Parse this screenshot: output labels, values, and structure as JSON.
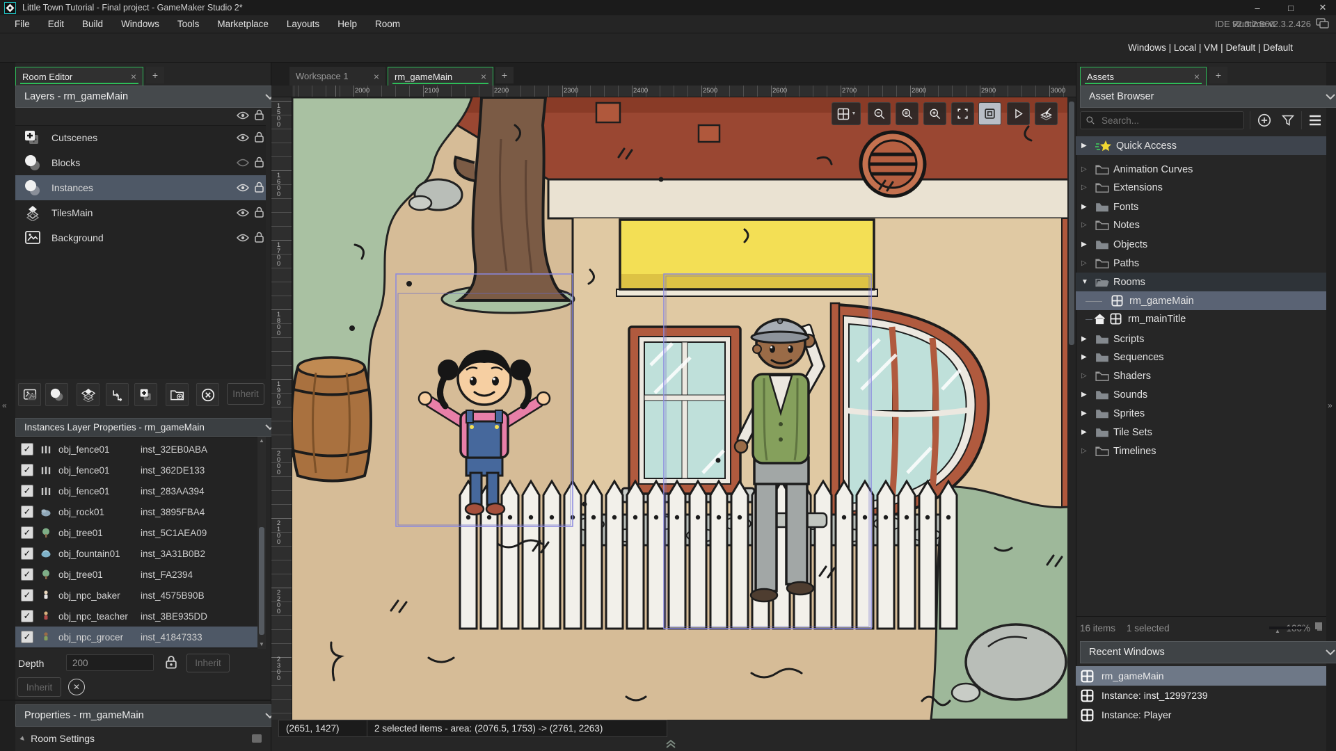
{
  "window": {
    "title": "Little Town Tutorial - Final project - GameMaker Studio 2*"
  },
  "menu": {
    "items": [
      "File",
      "Edit",
      "Build",
      "Windows",
      "Tools",
      "Marketplace",
      "Layouts",
      "Help",
      "Room"
    ],
    "ide_version": "IDE v2.3.2.560",
    "runtime_version": "Runtime v2.3.2.426"
  },
  "toolbar": {
    "target_config": "Windows | Local | VM | Default | Default"
  },
  "left_panel": {
    "tab_label": "Room Editor",
    "layers_header": "Layers - rm_gameMain",
    "layers": [
      {
        "label": "Cutscenes"
      },
      {
        "label": "Blocks"
      },
      {
        "label": "Instances"
      },
      {
        "label": "TilesMain"
      },
      {
        "label": "Background"
      }
    ],
    "inherit_button": "Inherit",
    "instances_header": "Instances Layer Properties - rm_gameMain",
    "instances": [
      {
        "object": "obj_fence01",
        "id": "inst_32EB0ABA"
      },
      {
        "object": "obj_fence01",
        "id": "inst_362DE133"
      },
      {
        "object": "obj_fence01",
        "id": "inst_283AA394"
      },
      {
        "object": "obj_rock01",
        "id": "inst_3895FBA4"
      },
      {
        "object": "obj_tree01",
        "id": "inst_5C1AEA09"
      },
      {
        "object": "obj_fountain01",
        "id": "inst_3A31B0B2"
      },
      {
        "object": "obj_tree01",
        "id": "inst_FA2394"
      },
      {
        "object": "obj_npc_baker",
        "id": "inst_4575B90B"
      },
      {
        "object": "obj_npc_teacher",
        "id": "inst_3BE935DD"
      },
      {
        "object": "obj_npc_grocer",
        "id": "inst_41847333"
      }
    ],
    "depth_label": "Depth",
    "depth_value": "200",
    "depth_inherit": "Inherit",
    "inherit_button2": "Inherit",
    "properties_header": "Properties - rm_gameMain",
    "room_settings_label": "Room Settings"
  },
  "canvas": {
    "tabs": [
      {
        "label": "Workspace 1"
      },
      {
        "label": "rm_gameMain"
      }
    ],
    "ruler_x": [
      "2000",
      "2100",
      "2200",
      "2300",
      "2400",
      "2500",
      "2600",
      "2700",
      "2800",
      "2900",
      "3000"
    ],
    "ruler_y": [
      "1500",
      "1600",
      "1700",
      "1800",
      "1900",
      "2000",
      "2100",
      "2200",
      "2300"
    ],
    "status_cursor": "(2651, 1427)",
    "status_selection": "2 selected items - area: (2076.5, 1753) -> (2761, 2263)"
  },
  "assets": {
    "tab_label": "Assets",
    "header": "Asset Browser",
    "search_placeholder": "Search...",
    "tree": [
      {
        "label": "Quick Access"
      },
      {
        "label": "Animation Curves"
      },
      {
        "label": "Extensions"
      },
      {
        "label": "Fonts"
      },
      {
        "label": "Notes"
      },
      {
        "label": "Objects"
      },
      {
        "label": "Paths"
      },
      {
        "label": "Rooms"
      },
      {
        "label": "rm_gameMain"
      },
      {
        "label": "rm_mainTitle"
      },
      {
        "label": "Scripts"
      },
      {
        "label": "Sequences"
      },
      {
        "label": "Shaders"
      },
      {
        "label": "Sounds"
      },
      {
        "label": "Sprites"
      },
      {
        "label": "Tile Sets"
      },
      {
        "label": "Timelines"
      }
    ],
    "items_count": "16 items",
    "selected_count": "1 selected",
    "zoom_level": "100%",
    "recent_header": "Recent Windows",
    "recent": [
      {
        "label": "rm_gameMain"
      },
      {
        "label": "Instance: inst_12997239"
      },
      {
        "label": "Instance: Player"
      }
    ]
  }
}
